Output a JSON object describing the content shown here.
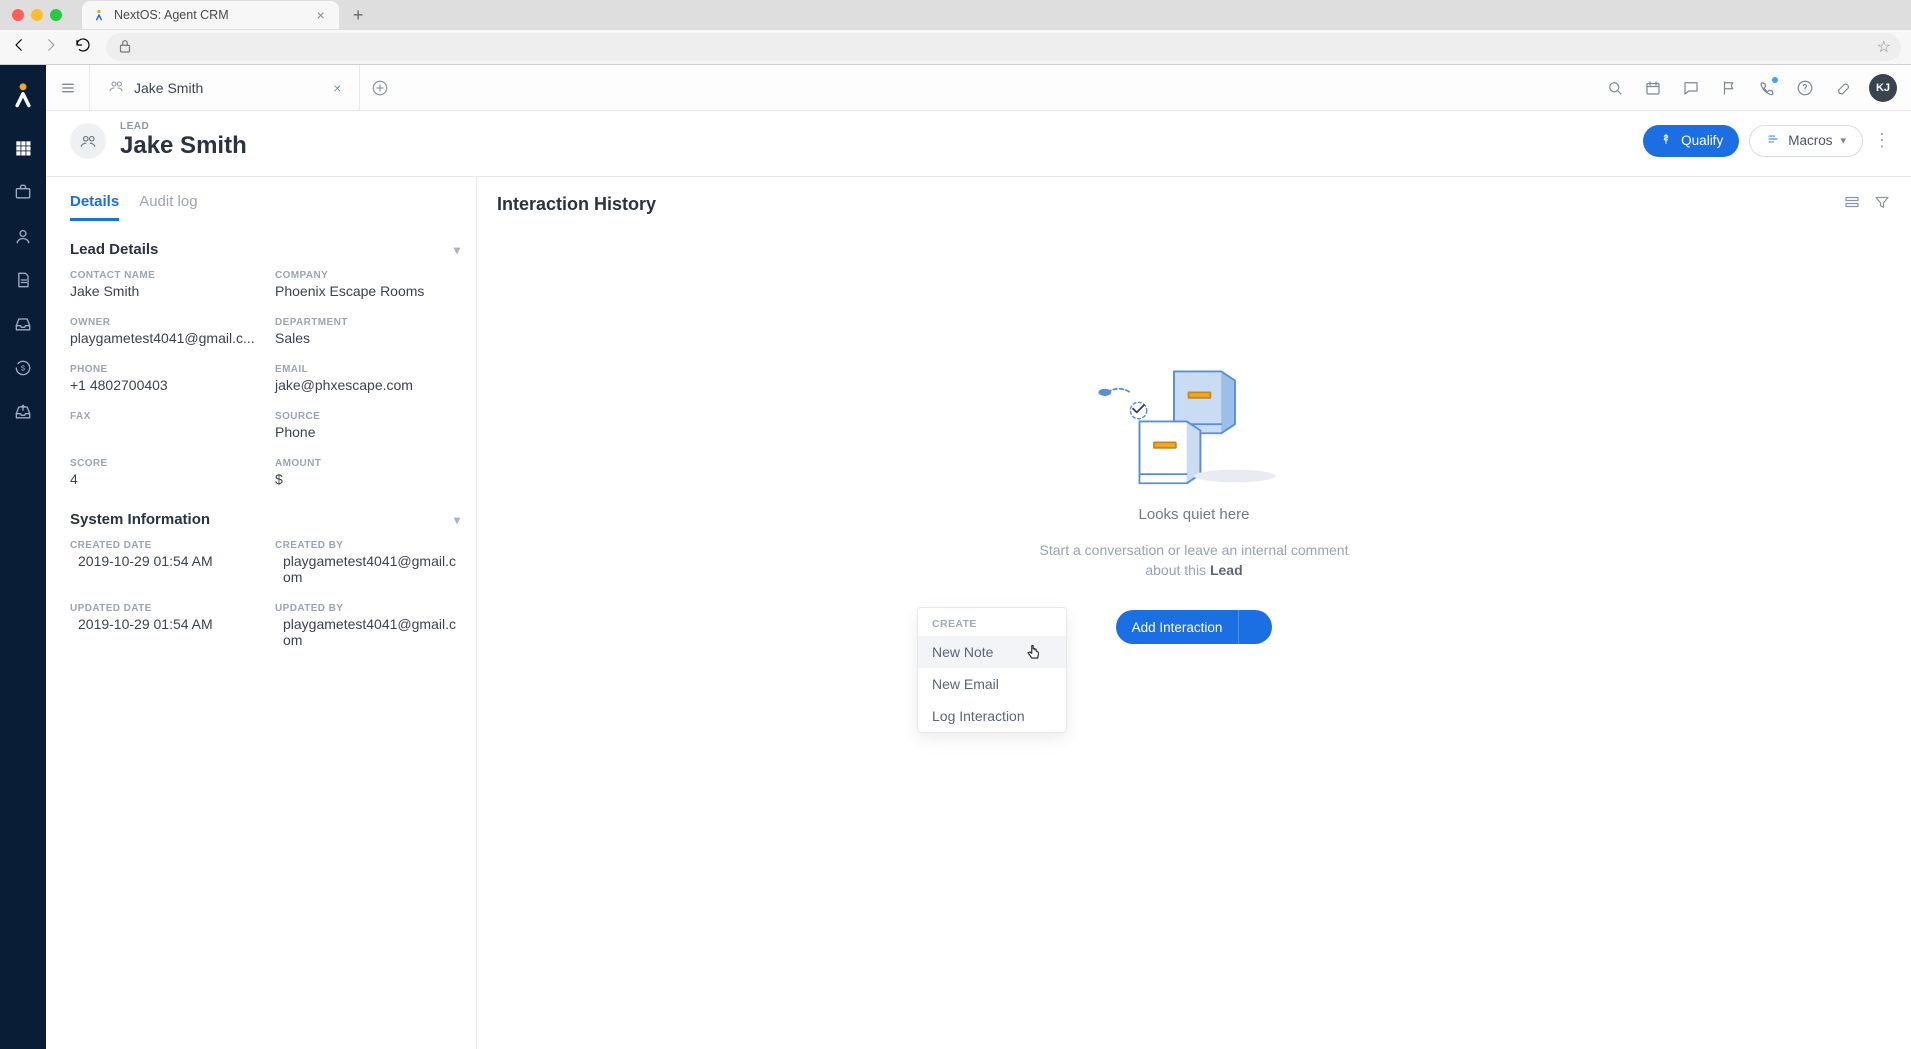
{
  "browser": {
    "tab_title": "NextOS: Agent CRM"
  },
  "workspace": {
    "tab_label": "Jake Smith",
    "avatar": "KJ"
  },
  "record": {
    "type": "LEAD",
    "name": "Jake Smith",
    "qualify_btn": "Qualify",
    "macros_btn": "Macros"
  },
  "left": {
    "tab_details": "Details",
    "tab_audit": "Audit log",
    "section_lead_details": "Lead Details",
    "section_system_info": "System Information",
    "fields": {
      "contact_name_label": "CONTACT NAME",
      "contact_name": "Jake Smith",
      "company_label": "COMPANY",
      "company": "Phoenix Escape Rooms",
      "owner_label": "OWNER",
      "owner": "playgametest4041@gmail.c...",
      "department_label": "DEPARTMENT",
      "department": "Sales",
      "phone_label": "PHONE",
      "phone": "+1 4802700403",
      "email_label": "EMAIL",
      "email": "jake@phxescape.com",
      "fax_label": "FAX",
      "fax": "",
      "source_label": "SOURCE",
      "source": "Phone",
      "score_label": "SCORE",
      "score": "4",
      "amount_label": "AMOUNT",
      "amount": "$",
      "created_date_label": "CREATED DATE",
      "created_date": "2019-10-29 01:54 AM",
      "created_by_label": "CREATED BY",
      "created_by": "playgametest4041@gmail.com",
      "updated_date_label": "UPDATED DATE",
      "updated_date": "2019-10-29 01:54 AM",
      "updated_by_label": "UPDATED BY",
      "updated_by": "playgametest4041@gmail.com"
    }
  },
  "right": {
    "title": "Interaction History",
    "empty_title": "Looks quiet here",
    "empty_sub_1": "Start a conversation or leave an internal comment about this ",
    "empty_sub_b": "Lead",
    "add_btn": "Add Interaction"
  },
  "dropdown": {
    "header": "CREATE",
    "item1": "New Note",
    "item2": "New Email",
    "item3": "Log Interaction"
  }
}
